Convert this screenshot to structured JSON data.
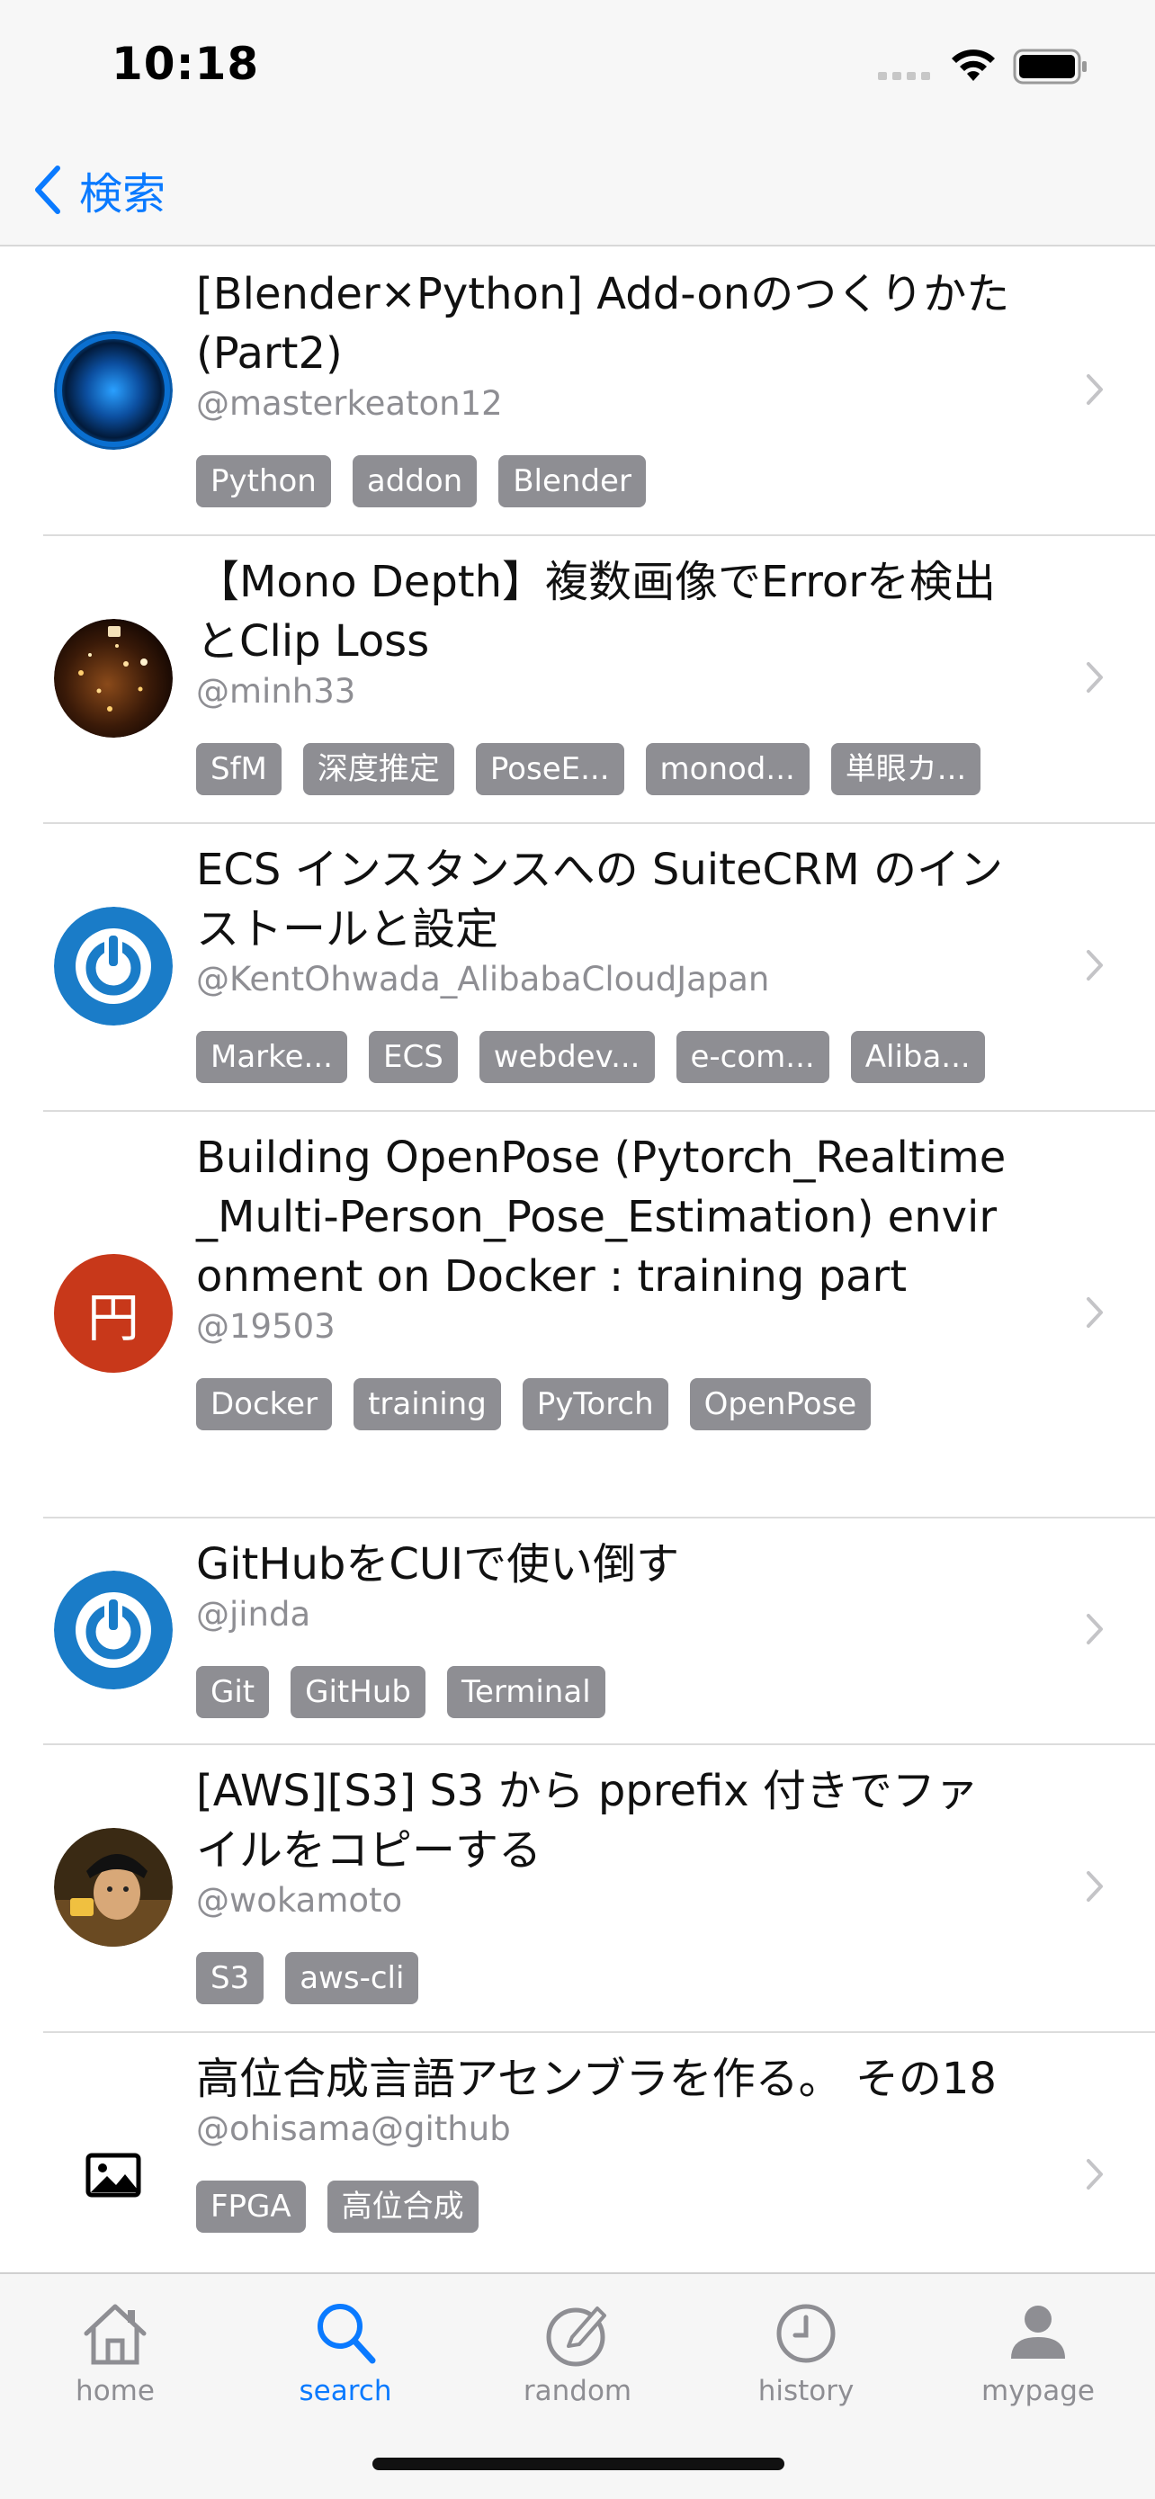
{
  "status": {
    "time": "10:18"
  },
  "nav": {
    "back_label": "検索"
  },
  "items": [
    {
      "title": "[Blender×Python] Add-onのつくりかた(Part2)",
      "author": "@masterkeaton12",
      "avatar": "blue-orb",
      "tags": [
        "Python",
        "addon",
        "Blender"
      ]
    },
    {
      "title": "【Mono Depth】複数画像でErrorを検出とClip Loss",
      "author": "@minh33",
      "avatar": "photo-night",
      "tags": [
        "SfM",
        "深度推定",
        "PoseE...",
        "monod...",
        "単眼カ..."
      ]
    },
    {
      "title": "ECS インスタンスへの SuiteCRM のインストールと設定",
      "author": "@KentOhwada_AlibabaCloudJapan",
      "avatar": "power-logo",
      "tags": [
        "Marke...",
        "ECS",
        "webdev...",
        "e-com...",
        "Aliba..."
      ]
    },
    {
      "title": "Building OpenPose (Pytorch_Realtime_Multi-Person_Pose_Estimation) environment on Docker : training part",
      "author": "@19503",
      "avatar": "yen-logo",
      "avatar_text": "円",
      "tags": [
        "Docker",
        "training",
        "PyTorch",
        "OpenPose"
      ]
    },
    {
      "title": "GitHubをCUIで使い倒す",
      "author": "@jinda",
      "avatar": "power-logo",
      "tags": [
        "Git",
        "GitHub",
        "Terminal"
      ]
    },
    {
      "title": "[AWS][S3] S3 から pprefix 付きでファイルをコピーする",
      "author": "@wokamoto",
      "avatar": "photo-person",
      "tags": [
        "S3",
        "aws-cli"
      ]
    },
    {
      "title": "高位合成言語アセンブラを作る。 その18",
      "author": "@ohisama@github",
      "avatar": "image-placeholder",
      "tags": [
        "FPGA",
        "高位合成"
      ]
    }
  ],
  "tabs": [
    {
      "label": "home",
      "icon": "house-icon"
    },
    {
      "label": "search",
      "icon": "magnifier-icon",
      "active": true
    },
    {
      "label": "random",
      "icon": "pencil-circle-icon"
    },
    {
      "label": "history",
      "icon": "clock-icon"
    },
    {
      "label": "mypage",
      "icon": "person-icon"
    }
  ],
  "colors": {
    "accent": "#0a7aff",
    "tag_bg": "#8e8e93",
    "secondary_text": "#8e8e93"
  }
}
